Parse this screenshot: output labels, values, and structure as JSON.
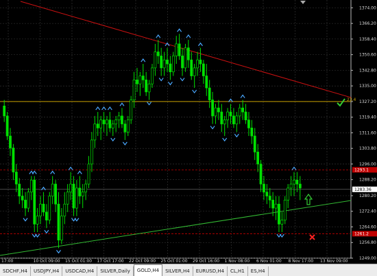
{
  "chart_data": {
    "type": "candlestick",
    "symbol": "GOLD",
    "timeframe": "H4",
    "price_axis_ticks": [
      "1374.00",
      "1366.20",
      "1358.40",
      "1350.60",
      "1342.80",
      "1335.00",
      "1327.20",
      "1319.40",
      "1311.60",
      "1303.80",
      "1296.00",
      "1288.20",
      "1280.20",
      "1272.40",
      "1264.60",
      "1256.80",
      "1249.00"
    ],
    "price_tags": {
      "current": "1283.36",
      "alert_line": "1327.20",
      "alert_label": "23.4",
      "upper_red": "1293.1",
      "lower_red": "1261.2"
    },
    "time_axis_labels": [
      "17:00",
      "10 Oct 09:00",
      "15 Oct 01:00",
      "17 Oct 17:00",
      "22 Oct 09:00",
      "25 Oct 01:00",
      "29 Oct 16:00",
      "1 Nov 08:00",
      "6 Nov 01:00",
      "8 Nov 17:00",
      "13 Nov 09:00"
    ],
    "ylim": [
      1249.0,
      1377.9
    ],
    "candles": [
      [
        1325,
        1328,
        1317,
        1320
      ],
      [
        1320,
        1322,
        1308,
        1310
      ],
      [
        1310,
        1314,
        1300,
        1304
      ],
      [
        1304,
        1306,
        1288,
        1292
      ],
      [
        1292,
        1296,
        1282,
        1286
      ],
      [
        1286,
        1289,
        1276,
        1280
      ],
      [
        1280,
        1284,
        1274,
        1278
      ],
      [
        1278,
        1282,
        1270,
        1274
      ],
      [
        1274,
        1284,
        1272,
        1282
      ],
      [
        1282,
        1290,
        1278,
        1288
      ],
      [
        1288,
        1290,
        1262,
        1266
      ],
      [
        1266,
        1274,
        1262,
        1270
      ],
      [
        1270,
        1280,
        1266,
        1276
      ],
      [
        1276,
        1282,
        1270,
        1272
      ],
      [
        1272,
        1276,
        1264,
        1268
      ],
      [
        1268,
        1282,
        1266,
        1280
      ],
      [
        1280,
        1290,
        1276,
        1286
      ],
      [
        1286,
        1288,
        1272,
        1276
      ],
      [
        1276,
        1282,
        1254,
        1258
      ],
      [
        1258,
        1274,
        1256,
        1270
      ],
      [
        1270,
        1282,
        1266,
        1276
      ],
      [
        1276,
        1286,
        1272,
        1282
      ],
      [
        1282,
        1292,
        1278,
        1286
      ],
      [
        1286,
        1290,
        1270,
        1274
      ],
      [
        1274,
        1288,
        1270,
        1284
      ],
      [
        1284,
        1290,
        1276,
        1280
      ],
      [
        1280,
        1286,
        1274,
        1282
      ],
      [
        1282,
        1288,
        1278,
        1286
      ],
      [
        1286,
        1300,
        1284,
        1296
      ],
      [
        1296,
        1312,
        1292,
        1308
      ],
      [
        1308,
        1320,
        1304,
        1316
      ],
      [
        1316,
        1322,
        1310,
        1314
      ],
      [
        1314,
        1320,
        1308,
        1318
      ],
      [
        1318,
        1322,
        1312,
        1316
      ],
      [
        1316,
        1320,
        1310,
        1318
      ],
      [
        1318,
        1322,
        1312,
        1314
      ],
      [
        1314,
        1318,
        1310,
        1316
      ],
      [
        1316,
        1320,
        1312,
        1318
      ],
      [
        1318,
        1322,
        1314,
        1320
      ],
      [
        1320,
        1324,
        1314,
        1316
      ],
      [
        1316,
        1318,
        1308,
        1312
      ],
      [
        1312,
        1320,
        1310,
        1318
      ],
      [
        1318,
        1330,
        1316,
        1328
      ],
      [
        1328,
        1342,
        1324,
        1338
      ],
      [
        1338,
        1344,
        1332,
        1336
      ],
      [
        1336,
        1342,
        1330,
        1340
      ],
      [
        1340,
        1346,
        1334,
        1338
      ],
      [
        1338,
        1342,
        1330,
        1332
      ],
      [
        1332,
        1338,
        1328,
        1336
      ],
      [
        1336,
        1346,
        1334,
        1344
      ],
      [
        1344,
        1356,
        1340,
        1352
      ],
      [
        1352,
        1358,
        1346,
        1350
      ],
      [
        1350,
        1354,
        1340,
        1344
      ],
      [
        1344,
        1352,
        1340,
        1348
      ],
      [
        1348,
        1354,
        1342,
        1346
      ],
      [
        1346,
        1350,
        1338,
        1342
      ],
      [
        1342,
        1352,
        1340,
        1350
      ],
      [
        1350,
        1360,
        1346,
        1356
      ],
      [
        1356,
        1361,
        1348,
        1350
      ],
      [
        1350,
        1354,
        1340,
        1344
      ],
      [
        1344,
        1356,
        1342,
        1354
      ],
      [
        1354,
        1358,
        1344,
        1348
      ],
      [
        1348,
        1352,
        1338,
        1340
      ],
      [
        1340,
        1346,
        1334,
        1344
      ],
      [
        1344,
        1352,
        1340,
        1348
      ],
      [
        1348,
        1354,
        1342,
        1346
      ],
      [
        1346,
        1348,
        1336,
        1340
      ],
      [
        1340,
        1346,
        1330,
        1334
      ],
      [
        1334,
        1338,
        1324,
        1328
      ],
      [
        1328,
        1332,
        1316,
        1320
      ],
      [
        1320,
        1326,
        1316,
        1324
      ],
      [
        1324,
        1328,
        1318,
        1322
      ],
      [
        1322,
        1326,
        1312,
        1316
      ],
      [
        1316,
        1320,
        1310,
        1318
      ],
      [
        1318,
        1324,
        1314,
        1322
      ],
      [
        1322,
        1326,
        1316,
        1320
      ],
      [
        1320,
        1324,
        1314,
        1316
      ],
      [
        1316,
        1322,
        1312,
        1320
      ],
      [
        1320,
        1326,
        1316,
        1324
      ],
      [
        1324,
        1328,
        1318,
        1322
      ],
      [
        1322,
        1326,
        1316,
        1318
      ],
      [
        1318,
        1322,
        1310,
        1314
      ],
      [
        1314,
        1318,
        1306,
        1310
      ],
      [
        1310,
        1314,
        1298,
        1302
      ],
      [
        1302,
        1306,
        1292,
        1296
      ],
      [
        1296,
        1298,
        1282,
        1286
      ],
      [
        1286,
        1290,
        1278,
        1282
      ],
      [
        1282,
        1286,
        1276,
        1280
      ],
      [
        1280,
        1284,
        1274,
        1278
      ],
      [
        1278,
        1282,
        1270,
        1274
      ],
      [
        1274,
        1280,
        1268,
        1276
      ],
      [
        1276,
        1280,
        1262,
        1266
      ],
      [
        1266,
        1272,
        1262,
        1268
      ],
      [
        1268,
        1280,
        1266,
        1278
      ],
      [
        1278,
        1286,
        1274,
        1284
      ],
      [
        1284,
        1290,
        1280,
        1286
      ],
      [
        1286,
        1292,
        1280,
        1288
      ],
      [
        1288,
        1292,
        1282,
        1286
      ],
      [
        1286,
        1290,
        1278,
        1284
      ]
    ]
  },
  "tabs": [
    {
      "label": "SDCHF,H4"
    },
    {
      "label": "USDJPY,H4"
    },
    {
      "label": "USDCAD,H4"
    },
    {
      "label": "SILVER,Daily"
    },
    {
      "label": "GOLD,H4",
      "active": true
    },
    {
      "label": "SILVER,H4"
    },
    {
      "label": "EURUSD,H4"
    },
    {
      "label": "CL,H1"
    },
    {
      "label": "ES,H4"
    }
  ],
  "colors": {
    "background": "#000000",
    "candle": "#00e000",
    "grid": "#3a3a3a",
    "alert_line": "#c8a000",
    "red_line": "#c00000",
    "trend_green": "#33bb33",
    "arrow_marker": "#4aa8ff"
  },
  "icons": [
    "check-icon",
    "up-arrow-outline-icon",
    "close-x-icon",
    "dropdown-arrow-icon"
  ]
}
